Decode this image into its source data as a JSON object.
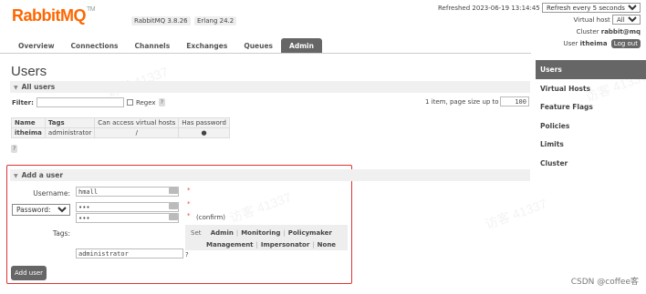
{
  "header": {
    "logo_text": "RabbitMQ",
    "logo_tm": "TM",
    "rabbitmq_version": "RabbitMQ 3.8.26",
    "erlang_version": "Erlang 24.2",
    "refreshed": "Refreshed 2023-06-19 13:14:45",
    "refresh_select": "Refresh every 5 seconds",
    "vhost_label": "Virtual host",
    "vhost_select": "All",
    "cluster_label": "Cluster",
    "cluster_name": "rabbit@mq",
    "user_label": "User",
    "user_name": "itheima",
    "logout_label": "Log out"
  },
  "nav": {
    "tabs": [
      {
        "label": "Overview"
      },
      {
        "label": "Connections"
      },
      {
        "label": "Channels"
      },
      {
        "label": "Exchanges"
      },
      {
        "label": "Queues"
      },
      {
        "label": "Admin"
      }
    ],
    "active": "Admin"
  },
  "page_title": "Users",
  "all_users": {
    "heading": "All users",
    "filter_label": "Filter:",
    "filter_value": "",
    "regex_label": "Regex",
    "help": "?",
    "paging_text": "1 item, page size up to",
    "page_size": "100",
    "columns": [
      "Name",
      "Tags",
      "Can access virtual hosts",
      "Has password"
    ],
    "rows": [
      {
        "name": "itheima",
        "tags": "administrator",
        "vhosts": "/",
        "has_password": "●"
      }
    ]
  },
  "add_user": {
    "heading": "Add a user",
    "username_label": "Username:",
    "username_value": "hmall",
    "password_select": "Password:",
    "password_value": "•••",
    "confirm_value": "•••",
    "confirm_label": "(confirm)",
    "required": "*",
    "tags_label": "Tags:",
    "set_label": "Set",
    "tag_options": [
      "Admin",
      "Monitoring",
      "Policymaker",
      "Management",
      "Impersonator",
      "None"
    ],
    "tags_value": "administrator",
    "help": "?",
    "submit_label": "Add user"
  },
  "sidebar": {
    "items": [
      {
        "label": "Users"
      },
      {
        "label": "Virtual Hosts"
      },
      {
        "label": "Feature Flags"
      },
      {
        "label": "Policies"
      },
      {
        "label": "Limits"
      },
      {
        "label": "Cluster"
      }
    ],
    "active": "Users"
  },
  "footer": {
    "credit": "CSDN @coffee客"
  },
  "watermark": "访客 41337",
  "colors": {
    "brand": "#ff6600",
    "active_tab": "#666666",
    "highlight_box": "#dd3333"
  }
}
